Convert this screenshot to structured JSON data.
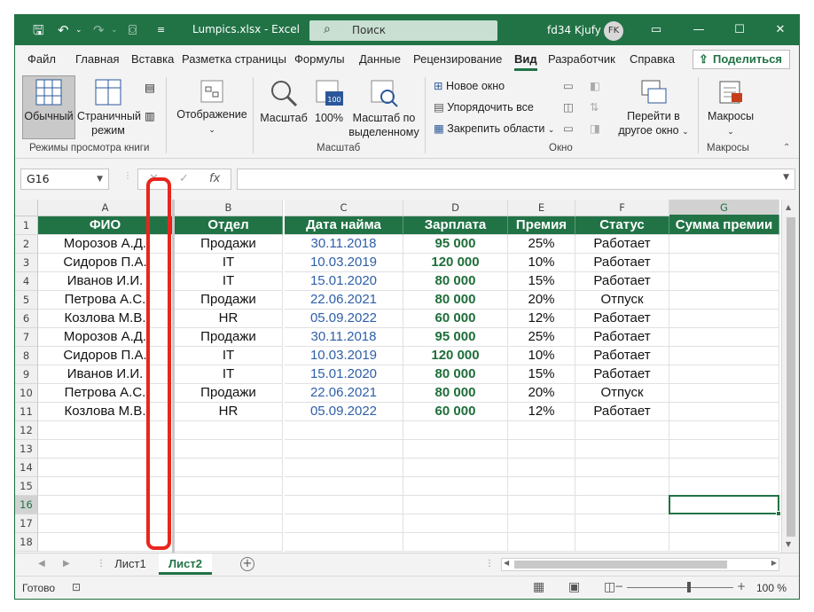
{
  "titlebar": {
    "filename": "Lumpics.xlsx",
    "app": "Excel",
    "separator": " - ",
    "search_placeholder": "Поиск",
    "user_name": "fd34 Kjufy",
    "avatar_initials": "FK"
  },
  "menu": {
    "tabs": [
      "Файл",
      "Главная",
      "Вставка",
      "Разметка страницы",
      "Формулы",
      "Данные",
      "Рецензирование",
      "Вид",
      "Разработчик",
      "Справка"
    ],
    "active_tab": "Вид",
    "share_label": "Поделиться"
  },
  "ribbon": {
    "views": {
      "normal": "Обычный",
      "page_layout_1": "Страничный",
      "page_layout_2": "режим",
      "group_label": "Режимы просмотра книги"
    },
    "display": "Отображение",
    "zoom": {
      "zoom_label": "Масштаб",
      "hundred_label": "100%",
      "hundred_icon_text": "100",
      "selection_1": "Масштаб по",
      "selection_2": "выделенному",
      "group_label": "Масштаб"
    },
    "window": {
      "new_window": "Новое окно",
      "arrange_all": "Упорядочить все",
      "freeze_panes": "Закрепить области",
      "switch_1": "Перейти в",
      "switch_2": "другое окно",
      "group_label": "Окно"
    },
    "macros": {
      "label": "Макросы",
      "group_label": "Макросы"
    }
  },
  "formula_bar": {
    "name_box": "G16",
    "fx": "fx",
    "cancel": "✕",
    "enter": "✓",
    "formula": ""
  },
  "columns": [
    "A",
    "B",
    "C",
    "D",
    "E",
    "F",
    "G"
  ],
  "selected_column": "G",
  "selected_row": "16",
  "row_numbers": [
    "1",
    "2",
    "3",
    "4",
    "5",
    "6",
    "7",
    "8",
    "9",
    "10",
    "11",
    "12",
    "13",
    "14",
    "15",
    "16",
    "17",
    "18"
  ],
  "table": {
    "headers": [
      "ФИО",
      "Отдел",
      "Дата найма",
      "Зарплата",
      "Премия",
      "Статус",
      "Сумма премии"
    ],
    "rows": [
      [
        "Морозов А.Д.",
        "Продажи",
        "30.11.2018",
        "95 000",
        "25%",
        "Работает",
        ""
      ],
      [
        "Сидоров П.А.",
        "IT",
        "10.03.2019",
        "120 000",
        "10%",
        "Работает",
        ""
      ],
      [
        "Иванов И.И.",
        "IT",
        "15.01.2020",
        "80 000",
        "15%",
        "Работает",
        ""
      ],
      [
        "Петрова А.С.",
        "Продажи",
        "22.06.2021",
        "80 000",
        "20%",
        "Отпуск",
        ""
      ],
      [
        "Козлова М.В.",
        "HR",
        "05.09.2022",
        "60 000",
        "12%",
        "Работает",
        ""
      ],
      [
        "Морозов А.Д.",
        "Продажи",
        "30.11.2018",
        "95 000",
        "25%",
        "Работает",
        ""
      ],
      [
        "Сидоров П.А.",
        "IT",
        "10.03.2019",
        "120 000",
        "10%",
        "Работает",
        ""
      ],
      [
        "Иванов И.И.",
        "IT",
        "15.01.2020",
        "80 000",
        "15%",
        "Работает",
        ""
      ],
      [
        "Петрова А.С.",
        "Продажи",
        "22.06.2021",
        "80 000",
        "20%",
        "Отпуск",
        ""
      ],
      [
        "Козлова М.В.",
        "HR",
        "05.09.2022",
        "60 000",
        "12%",
        "Работает",
        ""
      ]
    ]
  },
  "sheets": {
    "tabs": [
      "Лист1",
      "Лист2"
    ],
    "active": "Лист2"
  },
  "status": {
    "ready": "Готово",
    "zoom": "100 %",
    "zoom_minus": "−",
    "zoom_plus": "+"
  },
  "colors": {
    "excel_green": "#217346",
    "header_fill": "#217346",
    "date_text": "#2e5fa8",
    "money_text": "#1f6e39",
    "annotation_red": "#e8261d"
  },
  "icons": {
    "save": "save-icon",
    "undo": "undo-icon",
    "redo": "redo-icon",
    "camera": "camera-icon",
    "search": "search-icon",
    "share": "share-icon"
  }
}
